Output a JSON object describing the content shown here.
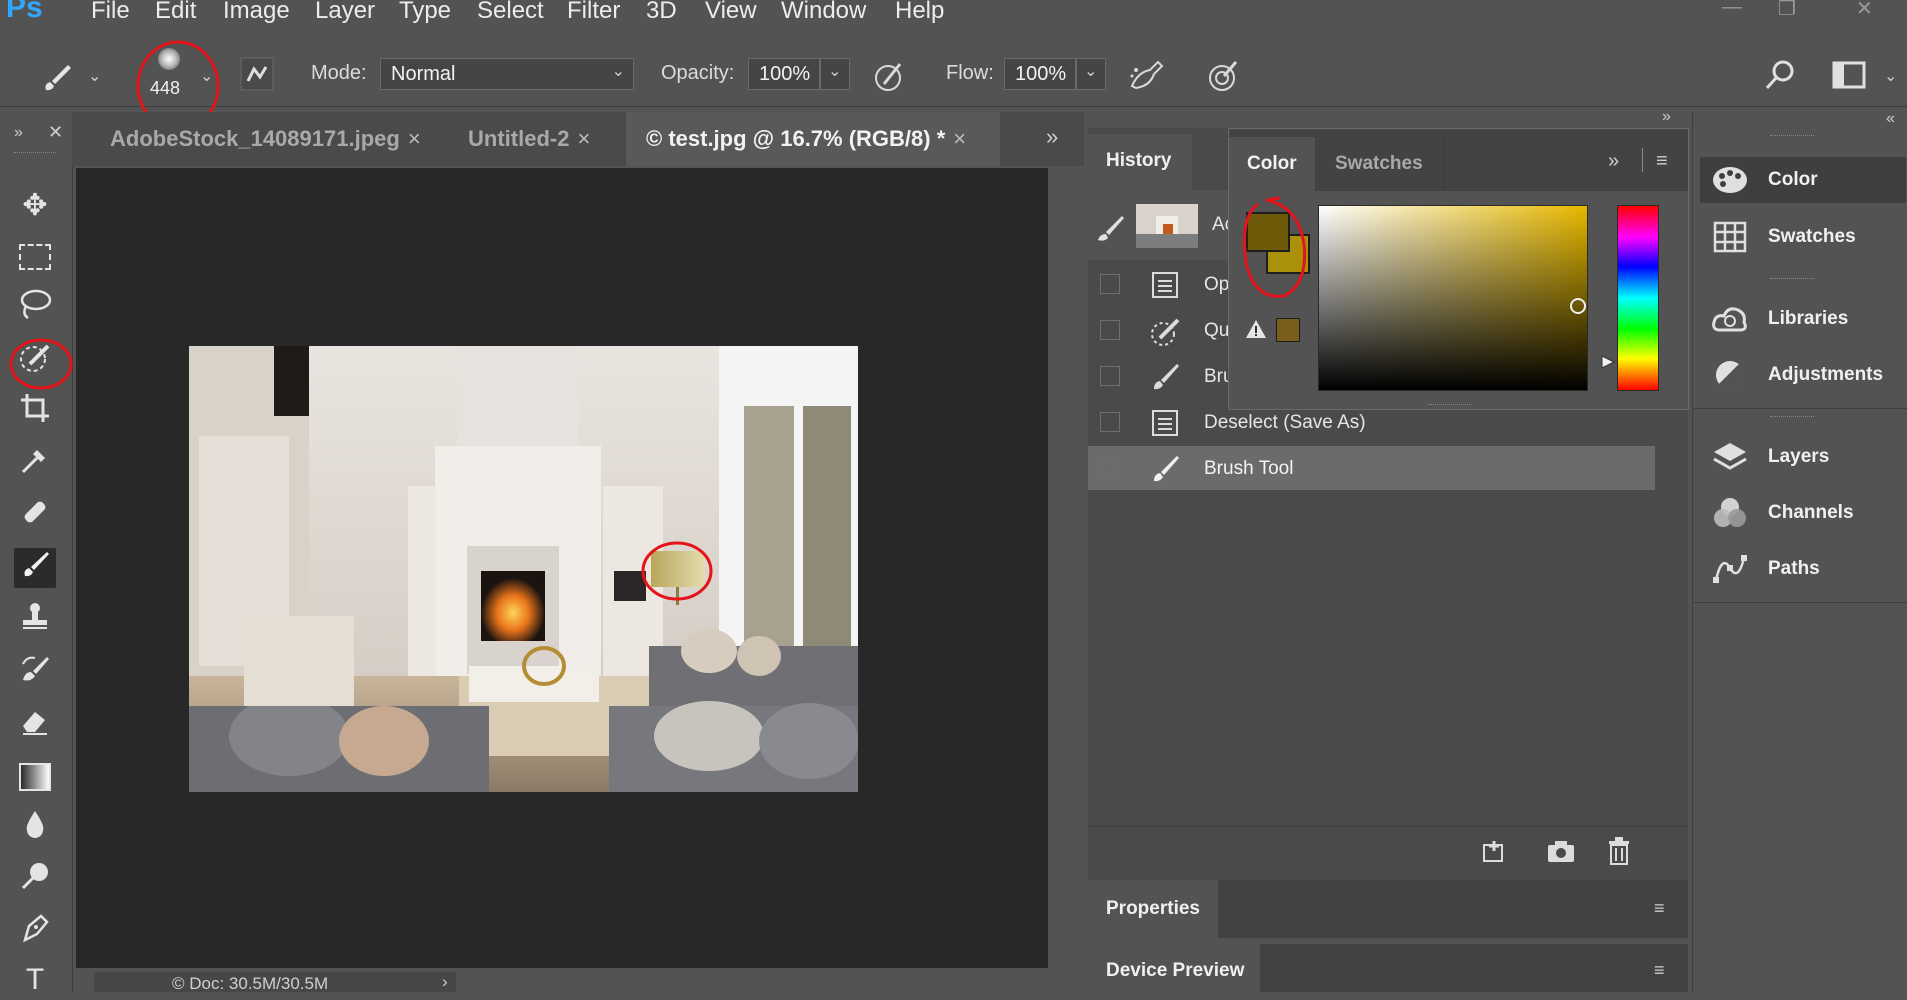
{
  "app": {
    "logo": "Ps"
  },
  "menu": [
    "File",
    "Edit",
    "Image",
    "Layer",
    "Type",
    "Select",
    "Filter",
    "3D",
    "View",
    "Window",
    "Help"
  ],
  "window_controls": [
    "—",
    "❐",
    "✕"
  ],
  "options": {
    "brush_size": "448",
    "mode_label": "Mode:",
    "mode_value": "Normal",
    "opacity_label": "Opacity:",
    "opacity_value": "100%",
    "flow_label": "Flow:",
    "flow_value": "100%"
  },
  "tabs": [
    {
      "label": "AdobeStock_14089171.jpeg",
      "close": "×"
    },
    {
      "label": "Untitled-2",
      "close": "×"
    },
    {
      "label": "© test.jpg @ 16.7% (RGB/8) *",
      "close": "×"
    }
  ],
  "status": {
    "doc": "© Doc: 30.5M/30.5M",
    "arrow": "›"
  },
  "history": {
    "title": "History",
    "snapshot_label": "Ac",
    "items": [
      {
        "label": "Op",
        "icon": "document-icon"
      },
      {
        "label": "Qu",
        "icon": "quick-selection-icon"
      },
      {
        "label": "Bru",
        "icon": "brush-icon"
      },
      {
        "label": "Deselect (Save As)",
        "icon": "document-icon"
      },
      {
        "label": "Brush Tool",
        "icon": "brush-icon",
        "selected": true
      }
    ]
  },
  "color_panel": {
    "tab_color": "Color",
    "tab_swatches": "Swatches",
    "foreground": "#6f5a0a",
    "background": "#ab9009",
    "warning_swatch": "#7a5f1c"
  },
  "properties": {
    "title": "Properties"
  },
  "device_preview": {
    "title": "Device Preview"
  },
  "dock": [
    "Color",
    "Swatches",
    "Libraries",
    "Adjustments",
    "Layers",
    "Channels",
    "Paths"
  ],
  "colors": {
    "accent": "#31a8ff",
    "annotation": "#e4141b"
  }
}
